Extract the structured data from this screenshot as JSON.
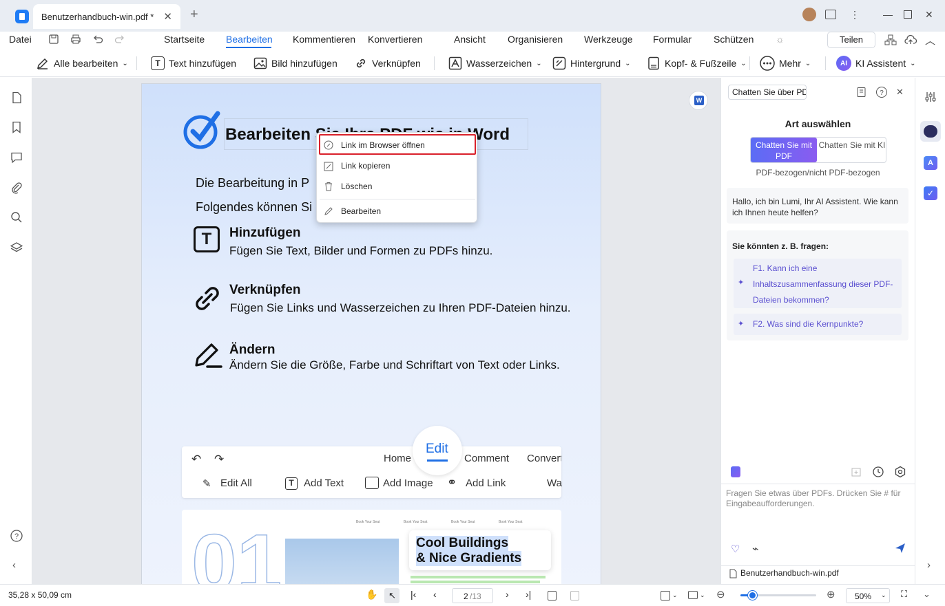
{
  "titlebar": {
    "tab_title": "Benutzerhandbuch-win.pdf *",
    "close": "✕",
    "new_tab": "+"
  },
  "menubar": {
    "file": "Datei",
    "tabs": [
      "Startseite",
      "Bearbeiten",
      "Kommentieren",
      "Konvertieren",
      "Ansicht",
      "Organisieren",
      "Werkzeuge",
      "Formular",
      "Schützen"
    ],
    "share": "Teilen"
  },
  "toolbar": {
    "items": [
      "Alle bearbeiten",
      "Text hinzufügen",
      "Bild hinzufügen",
      "Verknüpfen",
      "Wasserzeichen",
      "Hintergrund",
      "Kopf- & Fußzeile",
      "Mehr",
      "KI Assistent"
    ],
    "ai_badge": "AI"
  },
  "document": {
    "title": "Bearbeiten Sie Ihre PDF wie in Word",
    "line1": "Die Bearbeitung in P",
    "line2": "Folgendes können Si",
    "sections": [
      {
        "title": "Hinzufügen",
        "desc": "Fügen Sie Text, Bilder und Formen zu PDFs hinzu.",
        "icon": "T"
      },
      {
        "title": "Verknüpfen",
        "desc": "Fügen Sie Links und Wasserzeichen zu Ihren PDF-Dateien hinzu."
      },
      {
        "title": "Ändern",
        "desc": "Ändern Sie die Größe, Farbe und Schriftart von Text oder Links."
      }
    ],
    "inner": {
      "tabs": [
        "Home",
        "Edit",
        "Comment",
        "Convert"
      ],
      "tools": [
        "Edit All",
        "Add Text",
        "Add Image",
        "Add Link",
        "Wa"
      ],
      "big_number": "01",
      "card_title": "Cool Buildings & Nice Gradients",
      "card_line1": "Cool Buildings",
      "card_line2": "& Nice Gradients",
      "small_labels": [
        "Book Your Seat",
        "Book Your Seat",
        "Book Your Seat",
        "Book Your Seat"
      ]
    }
  },
  "context_menu": {
    "items": [
      "Link im Browser öffnen",
      "Link kopieren",
      "Löschen",
      "Bearbeiten"
    ]
  },
  "ai_panel": {
    "chat_select": "Chatten Sie über PDF",
    "heading": "Art auswählen",
    "mode_pdf": "Chatten Sie mit PDF",
    "mode_ki": "Chatten Sie mit KI",
    "mode_hint": "PDF-bezogen/nicht PDF-bezogen",
    "greeting": "Hallo, ich bin Lumi, Ihr AI Assistent. Wie kann ich Ihnen heute helfen?",
    "suggest_heading": "Sie könnten z. B. fragen:",
    "questions": [
      "F1. Kann ich eine Inhaltszusammenfassung dieser PDF-Dateien bekommen?",
      "F2. Was sind die Kernpunkte?"
    ],
    "input_placeholder": "Fragen Sie etwas über PDFs. Drücken Sie # für Eingabeaufforderungen.",
    "file_name": "Benutzerhandbuch-win.pdf"
  },
  "statusbar": {
    "dimensions": "35,28 x 50,09 cm",
    "page_current": "2",
    "page_total": "/13",
    "zoom": "50%",
    "zoom_level": 0.15
  },
  "colors": {
    "accent": "#1f6fe5",
    "highlight": "#d9202a",
    "ai_gradient_start": "#5b6cf5",
    "ai_gradient_end": "#8a5cf0"
  }
}
